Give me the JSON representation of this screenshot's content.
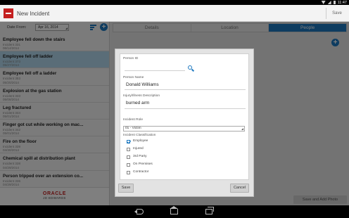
{
  "status_bar": {
    "time": "11:47"
  },
  "app": {
    "title": "New Incident",
    "save_label": "Save"
  },
  "filter": {
    "date_label": "Date From:",
    "date_value": "Apr 16, 2014"
  },
  "incidents": [
    {
      "title": "Employee fell down the stairs",
      "number": "Incident 331",
      "date": "06/14/2014"
    },
    {
      "title": "Employee fell off ladder",
      "number": "Incident 373",
      "date": "05/27/2014"
    },
    {
      "title": "Employee fell off a ladder",
      "number": "Incident 353",
      "date": "05/20/2014"
    },
    {
      "title": "Explosion at the gas station",
      "number": "Incident 333",
      "date": "05/08/2014"
    },
    {
      "title": "Leg fractured",
      "number": "Incident 344",
      "date": "05/01/2014"
    },
    {
      "title": "Finger got cut while working on mac...",
      "number": "Incident 342",
      "date": "05/01/2014"
    },
    {
      "title": "Fire on the floor",
      "number": "Incident 339",
      "date": "04/30/2014"
    },
    {
      "title": "Chemical spill at distribution plant",
      "number": "Incident 338",
      "date": "04/29/2014"
    },
    {
      "title": "Person tripped over an extension co...",
      "number": "Incident 336",
      "date": "04/29/2014"
    }
  ],
  "branding": {
    "name": "ORACLE",
    "sub": "JD EDWARDS"
  },
  "tabs": [
    {
      "label": "Details"
    },
    {
      "label": "Location"
    },
    {
      "label": "People"
    }
  ],
  "bottom": {
    "save_add_photo": "Save and Add Photo"
  },
  "modal": {
    "person_id_label": "Person ID",
    "person_id_value": "",
    "person_name_label": "Person Name",
    "person_name_value": "Donald Williams",
    "injury_label": "Injury/Illness Description",
    "injury_value": "burned arm",
    "role_label": "Incident Role",
    "role_value": "01 - Victim",
    "classification_label": "Incident Classification",
    "classifications": [
      {
        "label": "Employee",
        "checked": true
      },
      {
        "label": "Injured",
        "checked": false
      },
      {
        "label": "3rd Party",
        "checked": false
      },
      {
        "label": "On Premises",
        "checked": false
      },
      {
        "label": "Contractor",
        "checked": false
      }
    ],
    "save_label": "Save",
    "cancel_label": "Cancel"
  },
  "colors": {
    "accent": "#1c78c0",
    "brand": "#c42020",
    "selected_row": "#b4dbf0"
  }
}
